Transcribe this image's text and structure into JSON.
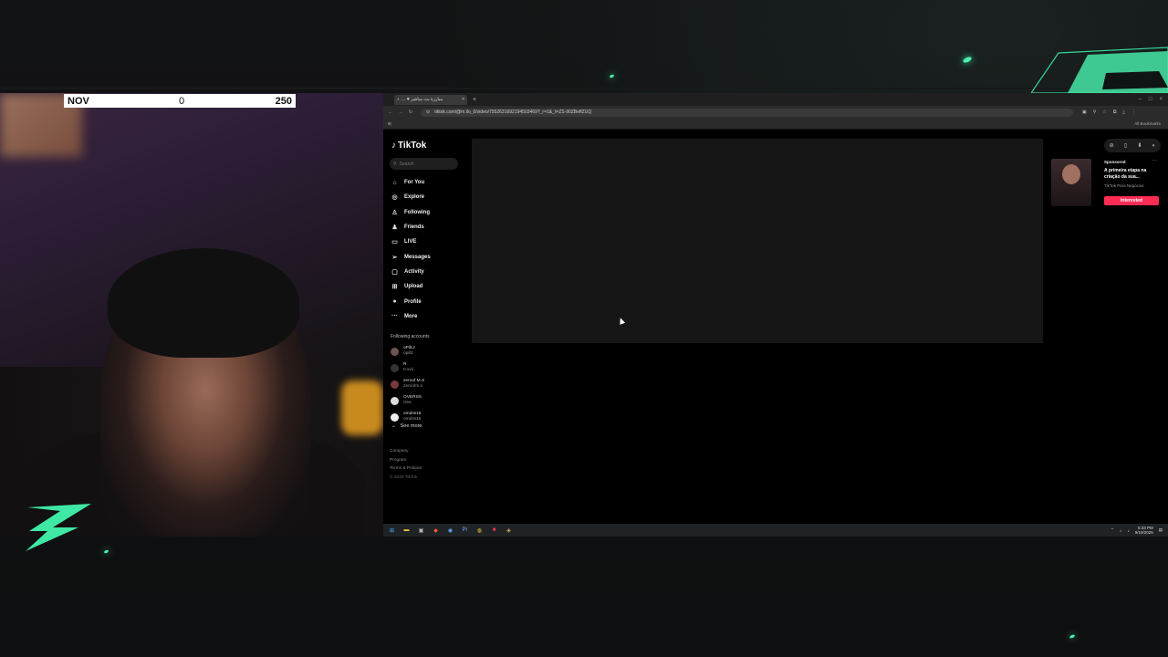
{
  "overlay": {
    "score": {
      "left": "NOV",
      "middle": "0",
      "right": "250"
    }
  },
  "browser": {
    "tab_title": "… ♥ مبارزة بث مباشر",
    "tab_close": "×",
    "tab_new": "+",
    "url": "tiktok.com/@m.llo_0/video/7552631692194503469?_r=1&_t=ZS-90ZBeffZUQ",
    "window_controls": [
      "–",
      "□",
      "×"
    ],
    "all_bookmarks": "All Bookmarks"
  },
  "tiktok": {
    "logo": "TikTok",
    "search_placeholder": "Search",
    "nav": [
      {
        "icon": "home-icon",
        "glyph": "⌂",
        "label": "For You"
      },
      {
        "icon": "compass-icon",
        "glyph": "◎",
        "label": "Explore"
      },
      {
        "icon": "following-icon",
        "glyph": "♙",
        "label": "Following"
      },
      {
        "icon": "friends-icon",
        "glyph": "♟",
        "label": "Friends"
      },
      {
        "icon": "live-icon",
        "glyph": "▭",
        "label": "LIVE"
      },
      {
        "icon": "messages-icon",
        "glyph": "➢",
        "label": "Messages"
      },
      {
        "icon": "activity-icon",
        "glyph": "▢",
        "label": "Activity"
      },
      {
        "icon": "upload-icon",
        "glyph": "⊞",
        "label": "Upload"
      },
      {
        "icon": "profile-icon",
        "glyph": "●",
        "label": "Profile"
      },
      {
        "icon": "more-icon",
        "glyph": "···",
        "label": "More"
      }
    ],
    "following_header": "Following accounts",
    "accounts": [
      {
        "name": "oPilLz",
        "handle": "opillz"
      },
      {
        "name": "R",
        "handle": "0.vvii"
      },
      {
        "name": "zeroof M.S",
        "handle": "zeroofm.s"
      },
      {
        "name": "OVERSS",
        "handle": "i3os"
      },
      {
        "name": "omdss16",
        "handle": "omdss16"
      }
    ],
    "see_more": "See more",
    "footer": [
      "Company",
      "Program",
      "Terms & Policies"
    ],
    "copyright": "© 2025 TikTok",
    "ad": {
      "sponsored": "Sponsored",
      "title": "A primeira etapa na criação da sua...",
      "brand": "TikTok Para Negócios",
      "button": "Interested"
    }
  },
  "taskbar": {
    "time": "5:33 PM",
    "date": "9/19/2025"
  },
  "colors": {
    "accent": "#fe2c55",
    "glow": "#4cf0b0"
  }
}
